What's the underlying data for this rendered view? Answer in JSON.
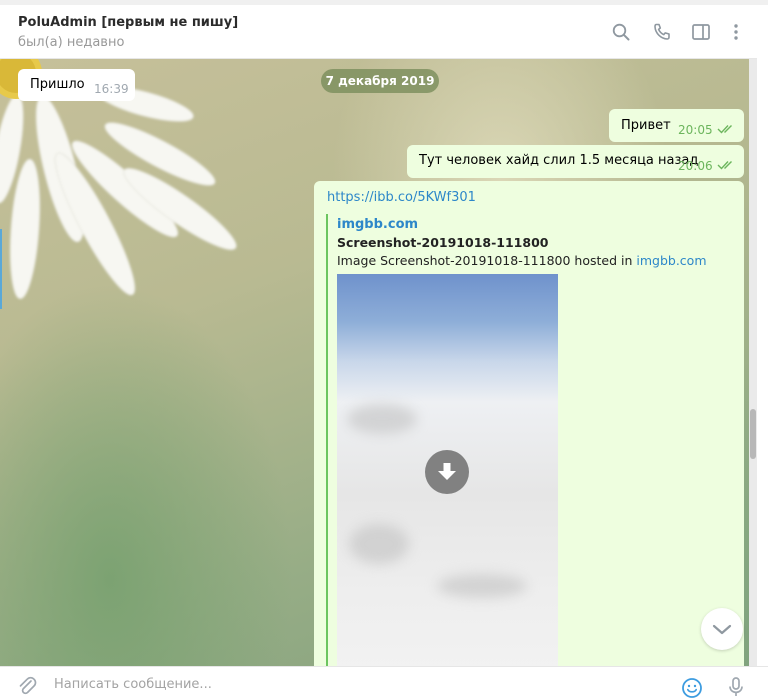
{
  "header": {
    "title": "PoluAdmin [первым не пишу]",
    "status": "был(а) недавно",
    "icons": [
      "search-icon",
      "phone-icon",
      "sidebar-toggle-icon",
      "more-vertical-icon"
    ]
  },
  "chat": {
    "date_chip": "7 декабря 2019",
    "messages": [
      {
        "direction": "in",
        "text": "Пришло",
        "time": "16:39"
      },
      {
        "direction": "out",
        "text": "Привет",
        "time": "20:05",
        "read": true
      },
      {
        "direction": "out",
        "text": "Тут человек хайд слил  1.5 месяца назад",
        "time": "20:06",
        "read": true
      },
      {
        "direction": "out",
        "url": "https://ibb.co/5KWf301",
        "preview": {
          "site": "imgbb.com",
          "title": "Screenshot-20191018-111800",
          "description_prefix": "Image Screenshot-20191018-111800 hosted in ",
          "description_link": "imgbb.com",
          "image_state": "download-icon"
        }
      }
    ]
  },
  "composer": {
    "placeholder": "Написать сообщение...",
    "icons": [
      "attach-icon",
      "emoji-icon",
      "microphone-icon"
    ]
  },
  "colors": {
    "link": "#2d87c9",
    "outgoing_bubble": "#eefedf",
    "time_outgoing": "#6cb55d",
    "preview_bar": "#6cc560",
    "emoji_icon": "#3d9ce0"
  }
}
